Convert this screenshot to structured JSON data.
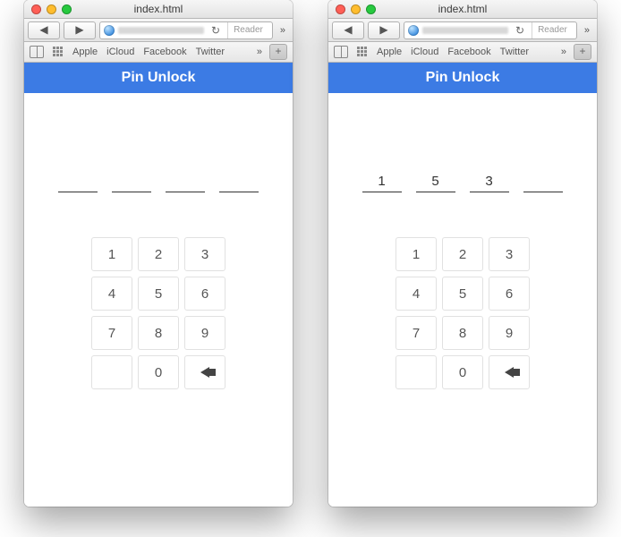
{
  "colors": {
    "accent": "#3c7be4"
  },
  "chrome": {
    "title": "index.html",
    "back": "◀",
    "forward": "▶",
    "reload": "↻",
    "reader": "Reader",
    "chevron": "»",
    "newtab": "+",
    "bookmarks": [
      "Apple",
      "iCloud",
      "Facebook",
      "Twitter"
    ]
  },
  "app": {
    "header": "Pin Unlock",
    "keys": [
      "1",
      "2",
      "3",
      "4",
      "5",
      "6",
      "7",
      "8",
      "9",
      "",
      "0",
      "←"
    ]
  },
  "screens": [
    {
      "pin": [
        "",
        "",
        "",
        ""
      ]
    },
    {
      "pin": [
        "1",
        "5",
        "3",
        ""
      ]
    }
  ]
}
